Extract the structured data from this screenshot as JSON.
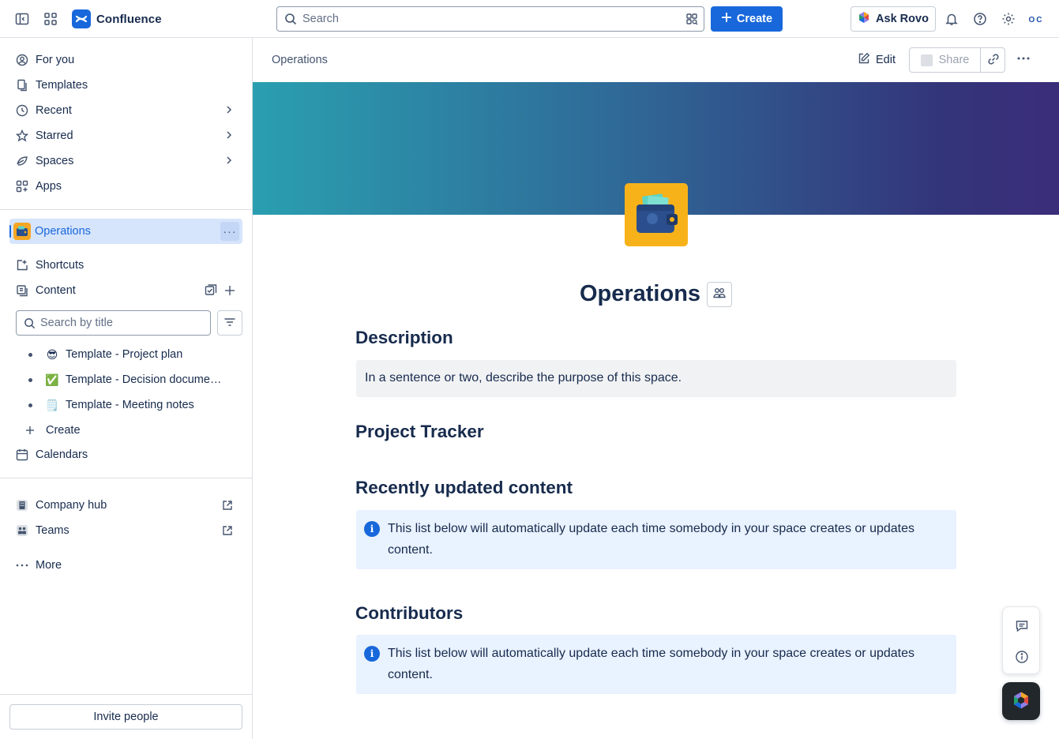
{
  "app": {
    "name": "Confluence"
  },
  "topbar": {
    "search_placeholder": "Search",
    "create_label": "Create",
    "ask_rovo_label": "Ask Rovo",
    "avatar_initials": "OC"
  },
  "sidebar": {
    "nav": [
      {
        "label": "For you",
        "icon": "user-circle-icon"
      },
      {
        "label": "Templates",
        "icon": "template-icon"
      },
      {
        "label": "Recent",
        "icon": "clock-icon"
      },
      {
        "label": "Starred",
        "icon": "star-icon"
      },
      {
        "label": "Spaces",
        "icon": "spaces-icon"
      },
      {
        "label": "Apps",
        "icon": "apps-icon"
      }
    ],
    "space_name": "Operations",
    "shortcuts_label": "Shortcuts",
    "content_label": "Content",
    "search_placeholder": "Search by title",
    "tree": [
      {
        "emoji": "😎",
        "title": "Template - Project plan"
      },
      {
        "emoji": "✅",
        "title": "Template - Decision documentation"
      },
      {
        "emoji": "🗒️",
        "title": "Template - Meeting notes"
      }
    ],
    "create_label": "Create",
    "calendars_label": "Calendars",
    "company_hub_label": "Company hub",
    "teams_label": "Teams",
    "more_label": "More",
    "invite_label": "Invite people"
  },
  "main": {
    "breadcrumb": "Operations",
    "edit_label": "Edit",
    "share_label": "Share",
    "title": "Operations",
    "sections": {
      "description_heading": "Description",
      "description_text": "In a sentence or two, describe the purpose of this space.",
      "tracker_heading": "Project Tracker",
      "recent_heading": "Recently updated content",
      "recent_info": "This list below will automatically update each time somebody in your space creates or updates content.",
      "contributors_heading": "Contributors",
      "contributors_info": "This list below will automatically update each time somebody in your space creates or updates content."
    }
  },
  "colors": {
    "brand_blue": "#1868db",
    "space_icon_bg": "#f7b21a",
    "banner_start": "#2a9fb0",
    "banner_end": "#3b2d7a",
    "info_bg": "#e9f2ff",
    "selected_bg": "#d6e4fc"
  }
}
